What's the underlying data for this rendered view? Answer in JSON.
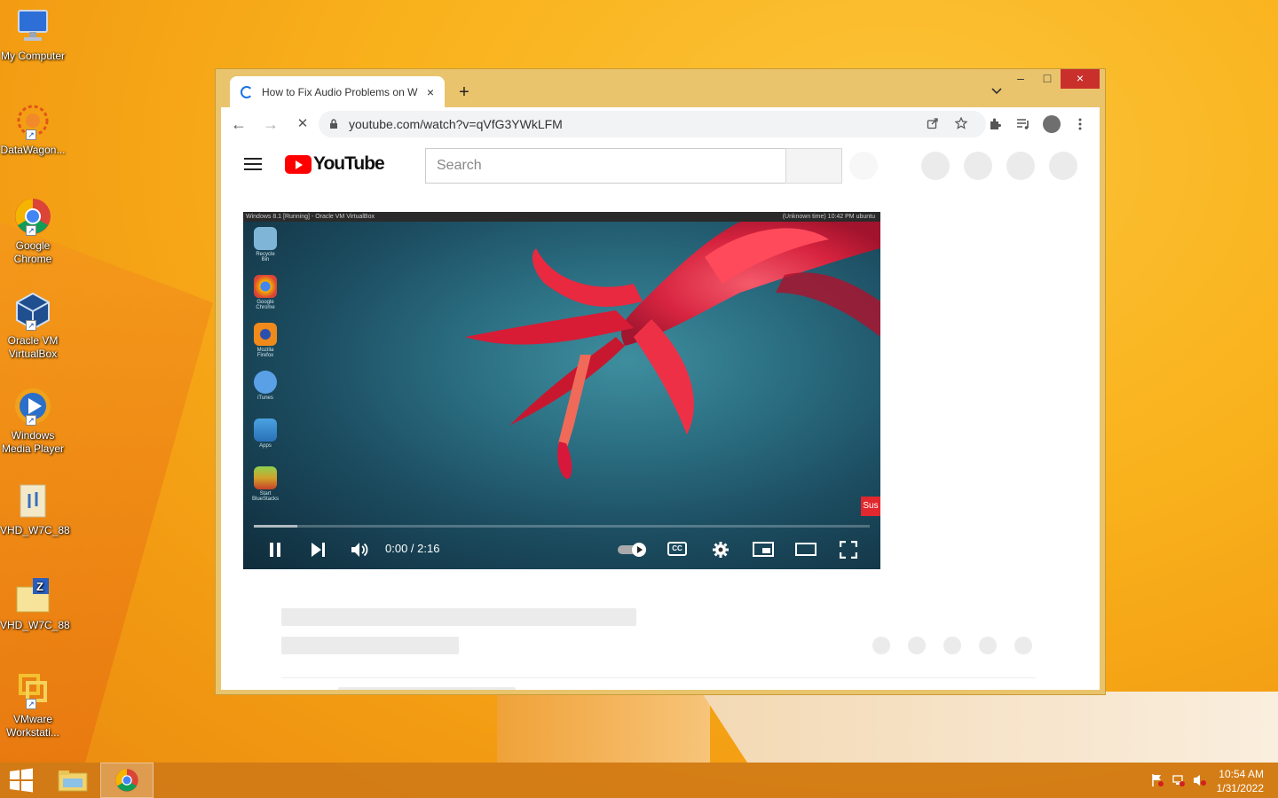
{
  "desktop": {
    "icons": [
      {
        "label": "My Computer"
      },
      {
        "label": "DataWagon..."
      },
      {
        "label": "Google Chrome"
      },
      {
        "label": "Oracle VM VirtualBox"
      },
      {
        "label": "Windows Media Player"
      },
      {
        "label": "VHD_W7C_88"
      },
      {
        "label": "VHD_W7C_88"
      },
      {
        "label": "VMware Workstati..."
      }
    ]
  },
  "browser": {
    "tab": {
      "title": "How to Fix Audio Problems on W",
      "close": "×"
    },
    "new_tab": "+",
    "tab_dropdown": "⌄",
    "window_controls": {
      "minimize": "–",
      "maximize": "□",
      "close": "×"
    },
    "nav": {
      "back": "←",
      "forward": "→",
      "reload": "✕"
    },
    "url": "youtube.com/watch?v=qVfG3YWkLFM"
  },
  "youtube": {
    "logo_text": "YouTube",
    "search_placeholder": "Search",
    "player": {
      "vm_title": "Windows 8.1 [Running] - Oracle VM VirtualBox",
      "vm_status": "(Unknown time)   10:42 PM   ubuntu",
      "vm_desktop_icons": [
        "Recycle Bin",
        "Google Chrome",
        "Mozilla Firefox",
        "iTunes",
        "Apps",
        "Start BlueStacks"
      ],
      "subscribe_tag": "Sus",
      "time": "0:00 / 2:16",
      "progress": 0.07,
      "cc_label": "CC"
    }
  },
  "taskbar": {
    "time": "10:54 AM",
    "date": "1/31/2022"
  }
}
